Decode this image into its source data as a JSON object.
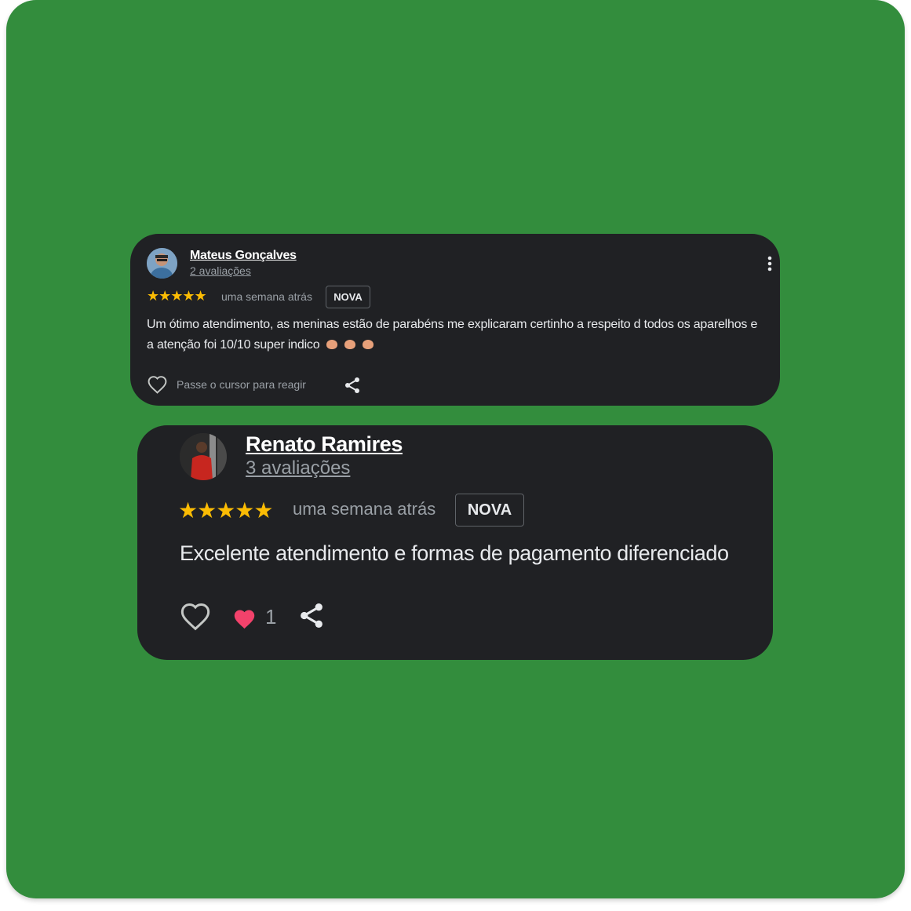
{
  "reviews": [
    {
      "author": "Mateus Gonçalves",
      "reviews_count": "2 avaliações",
      "stars": "★★★★★",
      "time": "uma semana atrás",
      "badge": "NOVA",
      "text": "Um ótimo atendimento, as meninas estão de parabéns me explicaram certinho a respeito d todos os aparelhos e a atenção foi 10/10 super indico",
      "emoji_icons": [
        "clapping-hands-icon",
        "clapping-hands-icon",
        "clapping-hands-icon"
      ],
      "react_hint": "Passe o cursor para reagir"
    },
    {
      "author": "Renato Ramires",
      "reviews_count": "3 avaliações",
      "stars": "★★★★★",
      "time": "uma semana atrás",
      "badge": "NOVA",
      "text": "Excelente atendimento e formas de pagamento diferenciado",
      "reaction_count": "1"
    }
  ],
  "colors": {
    "background": "#338d3d",
    "card": "#202124",
    "star": "#fbbc04",
    "reaction_heart": "#f2426b"
  }
}
